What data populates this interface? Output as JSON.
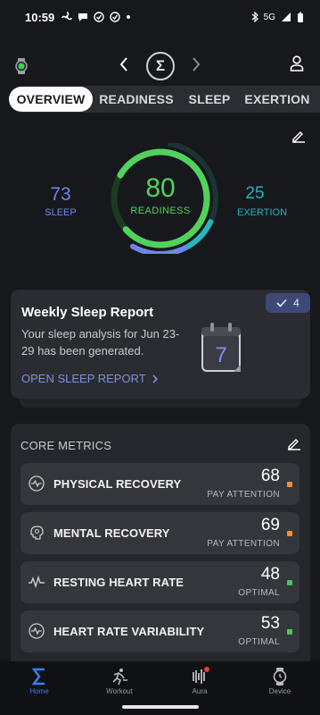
{
  "status_bar": {
    "time": "10:59",
    "network": "5G"
  },
  "nav": {
    "logo": "Σ"
  },
  "tabs": [
    {
      "label": "OVERVIEW",
      "active": true
    },
    {
      "label": "READINESS",
      "active": false
    },
    {
      "label": "SLEEP",
      "active": false
    },
    {
      "label": "EXERTION",
      "active": false
    }
  ],
  "gauge": {
    "readiness": {
      "value": "80",
      "label": "READINESS",
      "color": "#4fd35c",
      "fraction": 0.8
    },
    "sleep": {
      "value": "73",
      "label": "SLEEP",
      "color": "#6f86e8",
      "fraction": 0.73
    },
    "exertion": {
      "value": "25",
      "label": "EXERTION",
      "color": "#27b5c0",
      "fraction": 0.25
    }
  },
  "weekly_report": {
    "title": "Weekly Sleep Report",
    "body": "Your sleep analysis for Jun 23-29 has been generated.",
    "link": "OPEN SLEEP REPORT",
    "badge_count": "4",
    "calendar_day": "7"
  },
  "core_metrics": {
    "title": "CORE METRICS",
    "items": [
      {
        "label": "PHYSICAL RECOVERY",
        "value": "68",
        "status": "PAY ATTENTION",
        "status_color": "#f2912f",
        "icon": "pulse-icon"
      },
      {
        "label": "MENTAL RECOVERY",
        "value": "69",
        "status": "PAY ATTENTION",
        "status_color": "#f2912f",
        "icon": "brain-icon"
      },
      {
        "label": "RESTING HEART RATE",
        "value": "48",
        "status": "OPTIMAL",
        "status_color": "#45c95a",
        "icon": "heartbeat-icon"
      },
      {
        "label": "HEART RATE VARIABILITY",
        "value": "53",
        "status": "OPTIMAL",
        "status_color": "#45c95a",
        "icon": "hrv-icon"
      }
    ]
  },
  "bottom_nav": [
    {
      "label": "Home",
      "active": true
    },
    {
      "label": "Workout",
      "active": false
    },
    {
      "label": "Aura",
      "active": false
    },
    {
      "label": "Device",
      "active": false
    }
  ],
  "colors": {
    "accent": "#3d7cf0",
    "background": "#17181c"
  }
}
